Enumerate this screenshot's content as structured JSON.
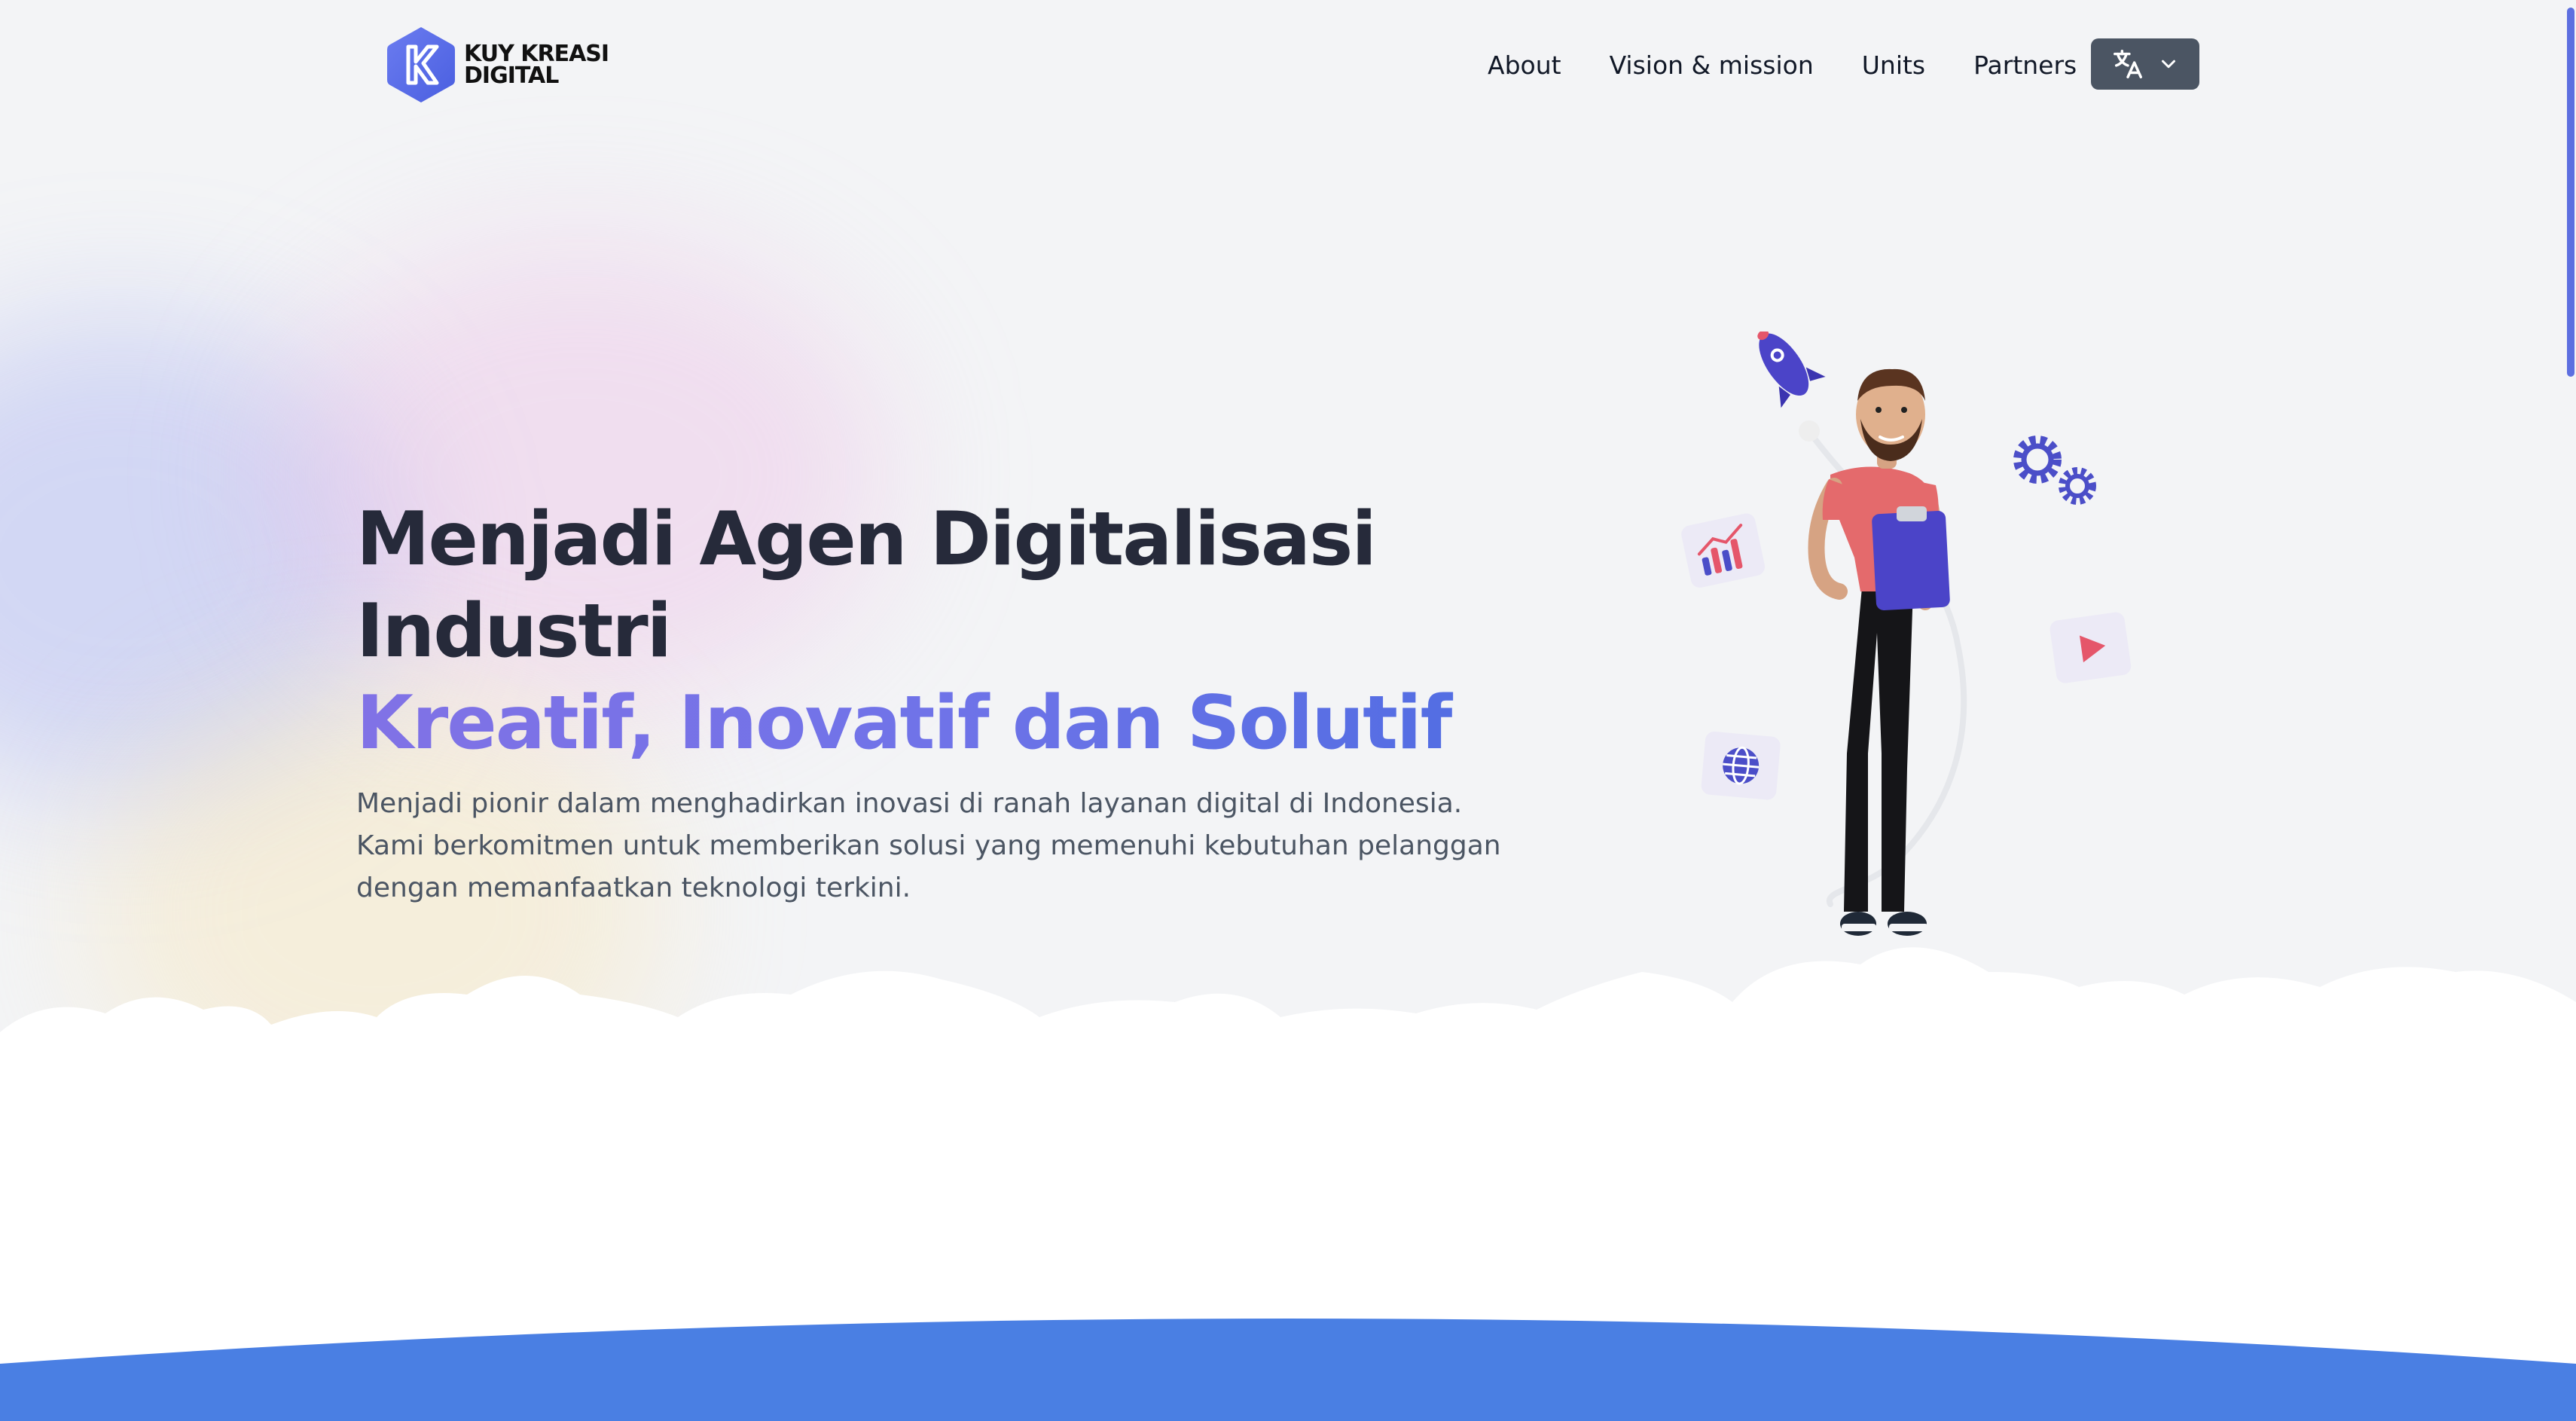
{
  "brand": {
    "name_line1": "KUY KREASI",
    "name_line2": "DIGITAL"
  },
  "nav": {
    "items": [
      {
        "label": "About"
      },
      {
        "label": "Vision & mission"
      },
      {
        "label": "Units"
      },
      {
        "label": "Partners"
      }
    ],
    "language_icon": "translate-icon",
    "language_chevron": "chevron-down-icon"
  },
  "hero": {
    "title_line1": "Menjadi Agen Digitalisasi Industri",
    "title_line2": "Kreatif, Inovatif dan Solutif",
    "description": "Menjadi pionir dalam menghadirkan inovasi di ranah layanan digital di Indonesia. Kami berkomitmen untuk memberikan solusi yang memenuhi kebutuhan pelanggan dengan memanfaatkan teknologi terkini."
  },
  "colors": {
    "accent": "#5b5ce2",
    "nav_button": "#4b5563",
    "bottom_band": "#4a7fe3"
  }
}
